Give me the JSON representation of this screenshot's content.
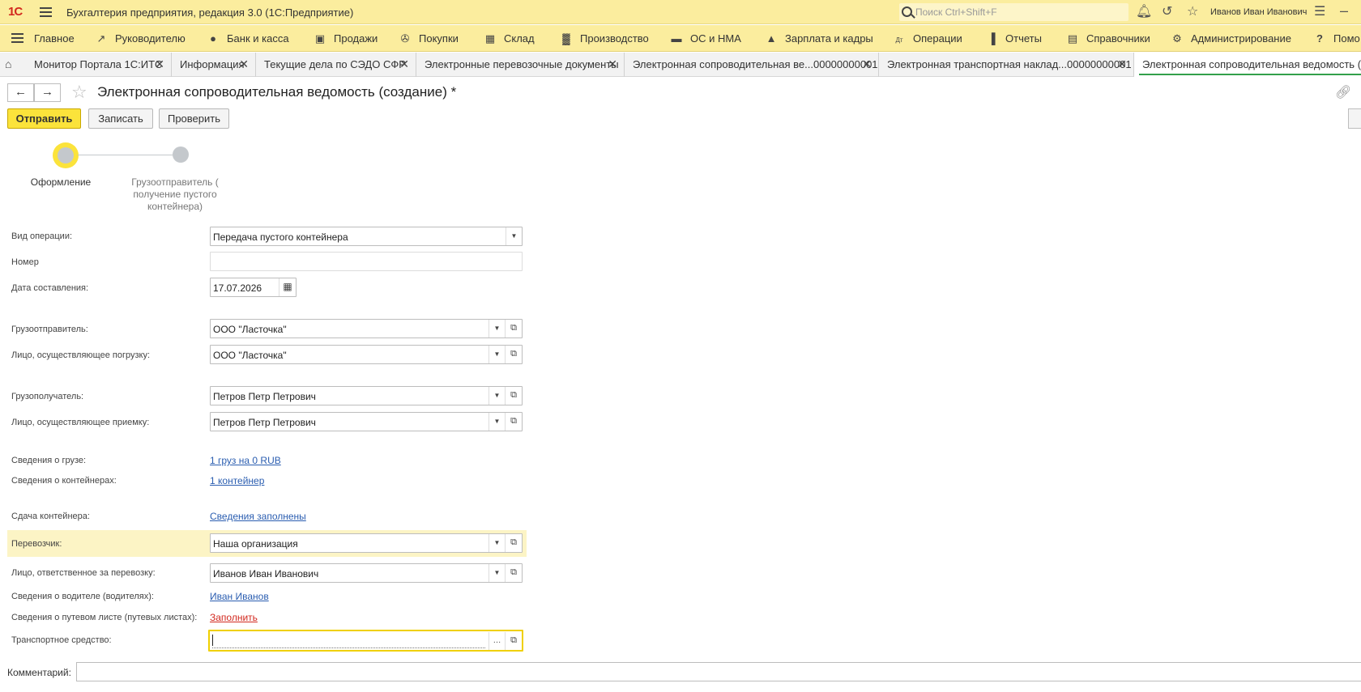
{
  "titlebar": {
    "logo": "1С",
    "app_title": "Бухгалтерия предприятия, редакция 3.0  (1С:Предприятие)",
    "search_placeholder": "Поиск Ctrl+Shift+F",
    "user_name": "Иванов Иван Иванович"
  },
  "sections": [
    {
      "label": "Главное",
      "icon": "menu-icon"
    },
    {
      "label": "Руководителю",
      "icon": "trend-icon"
    },
    {
      "label": "Банк и касса",
      "icon": "coin-icon"
    },
    {
      "label": "Продажи",
      "icon": "bag-icon"
    },
    {
      "label": "Покупки",
      "icon": "cart-icon"
    },
    {
      "label": "Склад",
      "icon": "grid-icon"
    },
    {
      "label": "Производство",
      "icon": "factory-icon"
    },
    {
      "label": "ОС и НМА",
      "icon": "truck-icon"
    },
    {
      "label": "Зарплата и кадры",
      "icon": "person-icon"
    },
    {
      "label": "Операции",
      "icon": "dt-kt-icon"
    },
    {
      "label": "Отчеты",
      "icon": "bar-chart-icon"
    },
    {
      "label": "Справочники",
      "icon": "books-icon"
    },
    {
      "label": "Администрирование",
      "icon": "gear-icon"
    },
    {
      "label": "Помо",
      "icon": "help-icon"
    }
  ],
  "tabs": [
    {
      "label": "Монитор Портала 1С:ИТС"
    },
    {
      "label": "Информация"
    },
    {
      "label": "Текущие дела по СЭДО СФР"
    },
    {
      "label": "Электронные перевозочные документы"
    },
    {
      "label": "Электронная сопроводительная ве...00000000001"
    },
    {
      "label": "Электронная транспортная наклад...00000000001"
    },
    {
      "label": "Электронная сопроводительная ведомость (со..."
    }
  ],
  "form": {
    "title": "Электронная сопроводительная ведомость (создание) *",
    "buttons": {
      "send": "Отправить",
      "save": "Записать",
      "check": "Проверить"
    },
    "steps": [
      {
        "label": "Оформление",
        "active": true
      },
      {
        "label": "Грузоотправитель ( получение пустого контейнера)",
        "active": false
      }
    ],
    "fields": {
      "operation_type": {
        "label": "Вид операции:",
        "value": "Передача пустого контейнера"
      },
      "number": {
        "label": "Номер",
        "value": ""
      },
      "date": {
        "label": "Дата составления:",
        "value": "17.07.2026"
      },
      "shipper": {
        "label": "Грузоотправитель:",
        "value": "ООО \"Ласточка\""
      },
      "loader": {
        "label": "Лицо, осуществляющее погрузку:",
        "value": "ООО \"Ласточка\""
      },
      "consignee": {
        "label": "Грузополучатель:",
        "value": "Петров Петр Петрович"
      },
      "receiver": {
        "label": "Лицо, осуществляющее приемку:",
        "value": "Петров Петр Петрович"
      },
      "cargo_info": {
        "label": "Сведения о грузе:",
        "link": "1 груз на 0 RUB"
      },
      "containers_info": {
        "label": "Сведения о контейнерах:",
        "link": "1 контейнер"
      },
      "container_handover": {
        "label": "Сдача контейнера:",
        "link": "Сведения заполнены"
      },
      "carrier": {
        "label": "Перевозчик:",
        "value": "Наша организация"
      },
      "responsible": {
        "label": "Лицо, ответственное за перевозку:",
        "value": "Иванов Иван Иванович"
      },
      "drivers": {
        "label": "Сведения о водителе (водителях):",
        "link": "Иван Иванов"
      },
      "waybills": {
        "label": "Сведения о путевом листе (путевых листах):",
        "link": "Заполнить"
      },
      "vehicle": {
        "label": "Транспортное средство:",
        "value": ""
      },
      "comment": {
        "label": "Комментарий:",
        "value": ""
      }
    }
  },
  "colors": {
    "accent_yellow": "#fbe33b",
    "header_bg": "#fbed9e",
    "link": "#2a5db0",
    "warning_link": "#d2281e",
    "active_tab_underline": "#33a04b"
  }
}
